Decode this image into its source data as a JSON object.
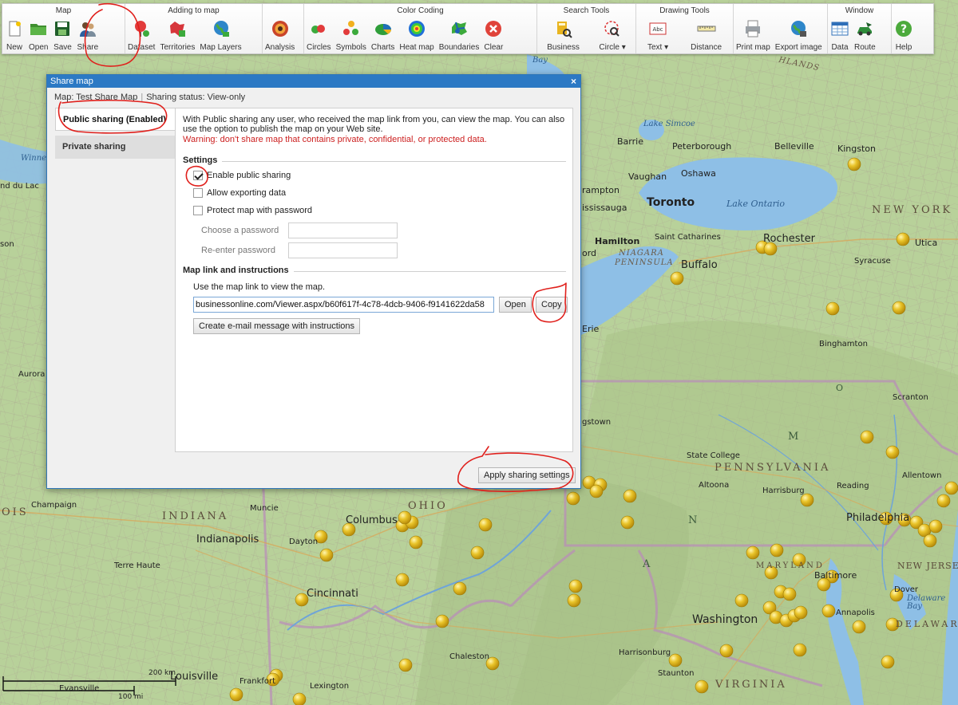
{
  "toolbar": {
    "groups": [
      {
        "title": "Map",
        "buttons": [
          {
            "label": "New",
            "icon": "new-file-icon"
          },
          {
            "label": "Open",
            "icon": "folder-icon"
          },
          {
            "label": "Save",
            "icon": "save-icon"
          },
          {
            "label": "Share",
            "icon": "share-users-icon"
          }
        ]
      },
      {
        "title": "Adding to map",
        "buttons": [
          {
            "label": "Dataset",
            "icon": "dataset-pin-icon"
          },
          {
            "label": "Territories",
            "icon": "territories-icon"
          },
          {
            "label": "Map Layers",
            "icon": "globe-layers-icon"
          }
        ]
      },
      {
        "title": "",
        "buttons": [
          {
            "label": "Analysis",
            "icon": "analysis-target-icon"
          }
        ]
      },
      {
        "title": "Color Coding",
        "buttons": [
          {
            "label": "Circles",
            "icon": "circles-icon"
          },
          {
            "label": "Symbols",
            "icon": "symbols-icon"
          },
          {
            "label": "Charts",
            "icon": "charts-icon"
          },
          {
            "label": "Heat map",
            "icon": "heat-map-icon"
          },
          {
            "label": "Boundaries",
            "icon": "boundaries-icon"
          },
          {
            "label": "Clear",
            "icon": "clear-icon"
          }
        ]
      },
      {
        "title": "Search Tools",
        "buttons": [
          {
            "label": "Business",
            "icon": "business-search-icon"
          },
          {
            "label": "Circle ▾",
            "icon": "circle-search-icon"
          }
        ]
      },
      {
        "title": "Drawing Tools",
        "buttons": [
          {
            "label": "Text ▾",
            "icon": "text-box-icon"
          },
          {
            "label": "Distance",
            "icon": "ruler-icon"
          }
        ]
      },
      {
        "title": "",
        "buttons": [
          {
            "label": "Print map",
            "icon": "printer-icon"
          },
          {
            "label": "Export image",
            "icon": "export-image-icon"
          }
        ]
      },
      {
        "title": "Window",
        "buttons": [
          {
            "label": "Data",
            "icon": "data-table-icon"
          },
          {
            "label": "Route",
            "icon": "route-car-icon"
          }
        ]
      },
      {
        "title": "",
        "buttons": [
          {
            "label": "Help",
            "icon": "help-icon"
          }
        ]
      }
    ]
  },
  "dialog": {
    "title": "Share map",
    "close": "×",
    "map_label": "Map: Test Share Map",
    "status_label": "Sharing status: View-only",
    "nav": {
      "public": "Public sharing (Enabled)",
      "private": "Private sharing"
    },
    "intro": "With Public sharing any user, who received the map link from you, can view the map. You can also use the option to publish the map on your Web site.",
    "warning": "Warning: don't share map that contains private, confidential, or protected data.",
    "settings_title": "Settings",
    "enable_public": "Enable public sharing",
    "enable_public_checked": true,
    "allow_export": "Allow exporting data",
    "allow_export_checked": false,
    "protect_password": "Protect map with password",
    "protect_password_checked": false,
    "choose_password": "Choose a password",
    "reenter_password": "Re-enter password",
    "link_title": "Map link and instructions",
    "link_desc": "Use the map link to view the map.",
    "link_value": "businessonline.com/Viewer.aspx/b60f617f-4c78-4dcb-9406-f9141622da58",
    "open_label": "Open",
    "copy_label": "Copy",
    "email_label": "Create e-mail message with instructions",
    "apply_label": "Apply sharing settings"
  },
  "map": {
    "labels": {
      "toronto": "Toronto",
      "lake_ontario": "Lake Ontario",
      "lake_simcoe": "Lake Simcoe",
      "barrie": "Barrie",
      "peterborough": "Peterborough",
      "belleville": "Belleville",
      "kingston": "Kingston",
      "vaughan": "Vaughan",
      "oshawa": "Oshawa",
      "rampton": "rampton",
      "ississauga": "ississauga",
      "hamilton": "Hamilton",
      "st_catharines": "Saint Catharines",
      "niagara": "NIAGARA",
      "peninsula": "PENINSULA",
      "buffalo": "Buffalo",
      "rochester": "Rochester",
      "utica": "Utica",
      "syracuse": "Syracuse",
      "new_york": "NEW YORK",
      "binghamton": "Binghamton",
      "scranton": "Scranton",
      "pennsylvania": "PENNSYLVANIA",
      "state_college": "State College",
      "altoona": "Altoona",
      "harrisburg": "Harrisburg",
      "reading": "Reading",
      "allentown": "Allentown",
      "philadelphia": "Philadelphia",
      "ohio": "OHIO",
      "columbus": "Columbus",
      "dayton": "Dayton",
      "cincinnati": "Cincinnati",
      "indiana": "INDIANA",
      "indianapolis": "Indianapolis",
      "muncie": "Muncie",
      "terre_haute": "Terre Haute",
      "champaign": "Champaign",
      "louisville": "Louisville",
      "lexington": "Lexington",
      "frankfort": "Frankfort",
      "evansville": "Evansville",
      "chaleston": "Chaleston",
      "harrisonburg": "Harrisonburg",
      "staunton": "Staunton",
      "virginia": "VIRGINIA",
      "washington": "Washington",
      "maryland": "MARYLAND",
      "baltimore": "Baltimore",
      "annapolis": "Annapolis",
      "dover": "Dover",
      "delaware_bay": "Delaware Bay",
      "delaware": "DELAWARE",
      "new_jersey": "NEW JERSEY",
      "erie": "Erie",
      "gstown": "gstown",
      "aurora": "Aurora",
      "ord": "ord",
      "winne": "Winne",
      "fond_du_lac": "nd du Lac",
      "son": "son",
      "ois": "OIS",
      "bay": "Bay",
      "highlands": "HLANDS",
      "oneida": "O",
      "poconos": "M",
      "appalachian": "A",
      "n_letter": "N"
    },
    "scale": {
      "km": "200 km",
      "mi": "100 mi"
    }
  }
}
